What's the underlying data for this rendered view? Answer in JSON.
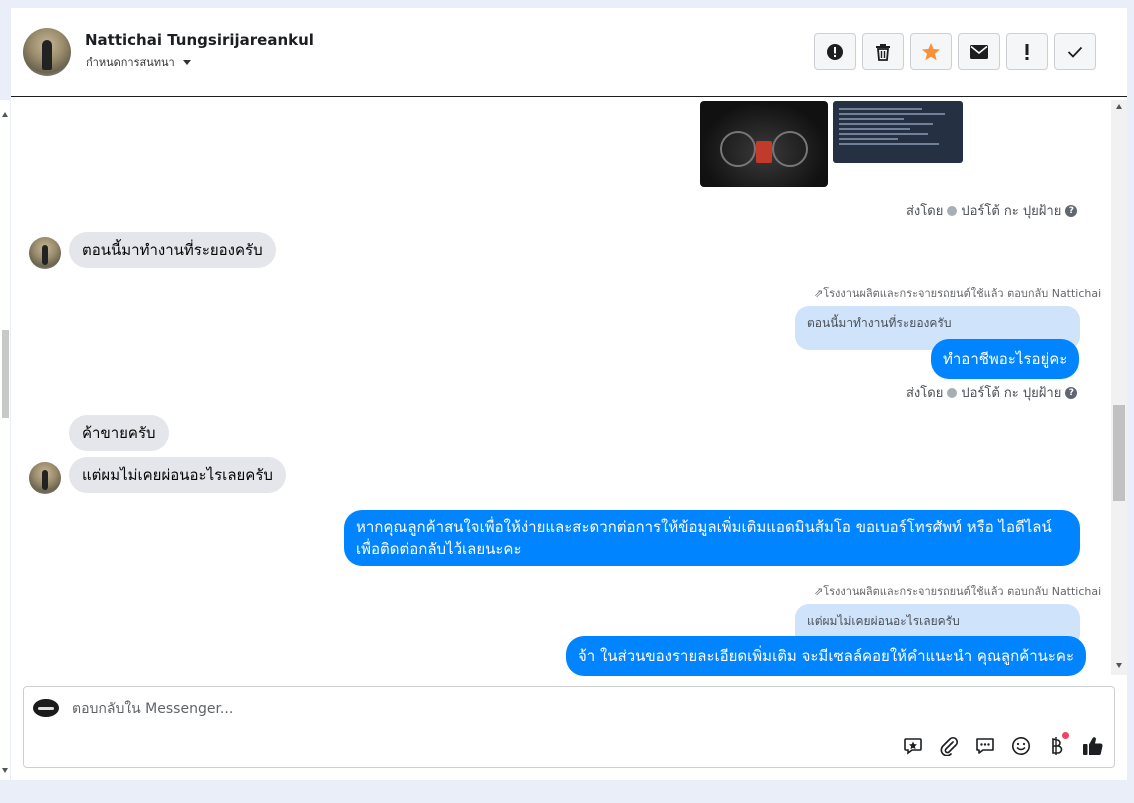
{
  "header": {
    "name": "Nattichai Tungsirijareankul",
    "subtitle": "กำหนดการสนทนา",
    "actions": [
      {
        "icon": "alert-circle-icon"
      },
      {
        "icon": "trash-icon"
      },
      {
        "icon": "star-icon",
        "color": "#f7923a"
      },
      {
        "icon": "mail-icon"
      },
      {
        "icon": "exclamation-icon"
      },
      {
        "icon": "check-icon"
      }
    ]
  },
  "messages": {
    "sent_by_1": "ส่งโดย",
    "sender_1": "ปอร์โต้ กะ ปุยฝ้าย",
    "in_1": "ตอนนี้มาทำงานที่ระยองครับ",
    "reply_meta_1": "โรงงานผลิตและกระจายรถยนต์ใช้แล้ว ตอบกลับ Nattichai",
    "quote_1": "ตอนนี้มาทำงานที่ระยองครับ",
    "out_1": "ทำอาชีพอะไรอยู่คะ",
    "sent_by_2": "ส่งโดย",
    "sender_2": "ปอร์โต้ กะ ปุยฝ้าย",
    "in_2": "ค้าขายครับ",
    "in_3": "แต่ผมไม่เคยผ่อนอะไรเลยครับ",
    "out_2_line1": "หากคุณลูกค้าสนใจเพื่อให้ง่ายและสะดวกต่อการให้ข้อมูลเพิ่มเติมแอดมินส้มโอ ขอเบอร์โทรศัพท์ หรือ ไอดีไลน์",
    "out_2_line2": "เพื่อติดต่อกลับไว้เลยนะคะ",
    "reply_meta_2": "โรงงานผลิตและกระจายรถยนต์ใช้แล้ว ตอบกลับ Nattichai",
    "quote_2": "แต่ผมไม่เคยผ่อนอะไรเลยครับ",
    "out_3": "จ้า ในส่วนของรายละเอียดเพิ่มเติม จะมีเซลล์คอยให้คำแนะนำ คุณลูกค้านะคะ"
  },
  "composer": {
    "placeholder": "ตอบกลับใน Messenger...",
    "tools": [
      "saved-reply-icon",
      "attachment-icon",
      "chat-bubble-icon",
      "emoji-icon",
      "baht-icon",
      "thumbs-up-icon"
    ],
    "accent": "#0084ff"
  }
}
